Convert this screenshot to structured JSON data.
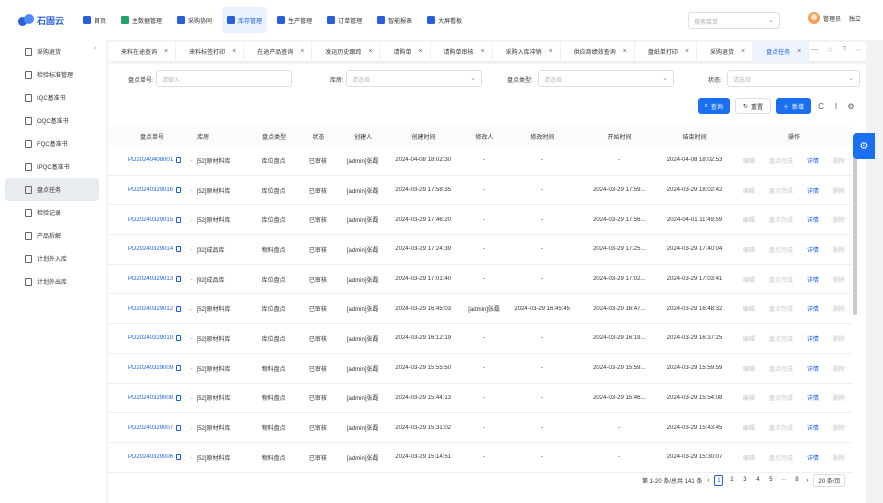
{
  "app": {
    "name": "石固云"
  },
  "topnav": {
    "items": [
      {
        "label": "首页",
        "icon": "home-icon",
        "color": "#2b5fd9"
      },
      {
        "label": "主数据管理",
        "icon": "database-icon",
        "color": "#22a06b"
      },
      {
        "label": "采购协同",
        "icon": "cart-icon",
        "color": "#2b5fd9"
      },
      {
        "label": "库存管理",
        "icon": "warehouse-icon",
        "color": "#2b5fd9",
        "active": true
      },
      {
        "label": "生产管理",
        "icon": "factory-icon",
        "color": "#2b5fd9"
      },
      {
        "label": "订单管理",
        "icon": "order-icon",
        "color": "#2b5fd9"
      },
      {
        "label": "智能报表",
        "icon": "report-icon",
        "color": "#2b5fd9"
      },
      {
        "label": "大屏看板",
        "icon": "dashboard-icon",
        "color": "#2b5fd9"
      }
    ],
    "search_placeholder": "搜索菜单",
    "user_name": "管理员",
    "logout": "独立"
  },
  "sidebar": {
    "items": [
      {
        "label": "采购退货"
      },
      {
        "label": "检验标准管理"
      },
      {
        "label": "IQC基准书"
      },
      {
        "label": "OQC基准书"
      },
      {
        "label": "FQC基准书"
      },
      {
        "label": "IPQC基准书"
      },
      {
        "label": "盘点任务",
        "active": true
      },
      {
        "label": "检验记录"
      },
      {
        "label": "产品拆解"
      },
      {
        "label": "计划外入库"
      },
      {
        "label": "计划外出库"
      }
    ]
  },
  "tabs": [
    {
      "label": "来料在途查询"
    },
    {
      "label": "来料标签打印"
    },
    {
      "label": "在途产品查询"
    },
    {
      "label": "发运历史跟踪"
    },
    {
      "label": "请购单"
    },
    {
      "label": "请购单审核"
    },
    {
      "label": "采购入库冲销"
    },
    {
      "label": "供应商绩效查询"
    },
    {
      "label": "盘纸单打印"
    },
    {
      "label": "采购退货"
    },
    {
      "label": "盘点任务",
      "active": true
    }
  ],
  "filters": {
    "code_label": "盘点单号:",
    "code_placeholder": "请输入",
    "warehouse_label": "库房:",
    "warehouse_placeholder": "请选择",
    "type_label": "盘点类型:",
    "type_placeholder": "请选择",
    "status_label": "状态:",
    "status_placeholder": "请选择"
  },
  "actions": {
    "query": "查询",
    "reset": "重置",
    "add": "新增"
  },
  "table": {
    "headers": [
      "盘点单号",
      "库房",
      "盘点类型",
      "状态",
      "创建人",
      "创建时间",
      "修改人",
      "修改时间",
      "开始时间",
      "结束时间",
      "操作"
    ],
    "op_labels": [
      "编辑",
      "盘点完成",
      "详情",
      "删除"
    ],
    "rows": [
      {
        "code": "PD20240408001",
        "warehouse": "[52]原材料库",
        "type": "库位盘点",
        "status": "已审核",
        "creator": "[admin]张磊",
        "ctime": "2024-04-08 18:02:30",
        "modifier": "-",
        "mtime": "-",
        "start": "-",
        "end": "2024-04-08 18:02:53"
      },
      {
        "code": "PD20240329016",
        "warehouse": "[52]原材料库",
        "type": "库位盘点",
        "status": "已审核",
        "creator": "[admin]张磊",
        "ctime": "2024-03-29 17:58:35",
        "modifier": "-",
        "mtime": "-",
        "start": "2024-03-29 17:59...",
        "end": "2024-03-29 18:02:42"
      },
      {
        "code": "PD20240329015",
        "warehouse": "[52]原材料库",
        "type": "库位盘点",
        "status": "已审核",
        "creator": "[admin]张磊",
        "ctime": "2024-03-29 17:46:20",
        "modifier": "-",
        "mtime": "-",
        "start": "2024-03-29 17:56...",
        "end": "2024-04-01 11:49:59"
      },
      {
        "code": "PD20240329014",
        "warehouse": "[32]成品库",
        "type": "物料盘点",
        "status": "已审核",
        "creator": "[admin]张磊",
        "ctime": "2024-03-29 17:24:39",
        "modifier": "-",
        "mtime": "-",
        "start": "2024-03-29 17:25...",
        "end": "2024-03-29 17:40:04"
      },
      {
        "code": "PD20240329013",
        "warehouse": "[92]成品库",
        "type": "库位盘点",
        "status": "已审核",
        "creator": "[admin]张磊",
        "ctime": "2024-03-29 17:01:40",
        "modifier": "-",
        "mtime": "-",
        "start": "2024-03-29 17:02...",
        "end": "2024-03-29 17:03:41"
      },
      {
        "code": "PD20240329012",
        "warehouse": "[52]原材料库",
        "type": "库位盘点",
        "status": "已审核",
        "creator": "[admin]张磊",
        "ctime": "2024-03-29 16:45:03",
        "modifier": "[admin]张磊",
        "mtime": "2024-03-29 16:45:45",
        "start": "2024-03-29 16:47...",
        "end": "2024-03-29 16:48:32"
      },
      {
        "code": "PD20240329010",
        "warehouse": "[52]原材料库",
        "type": "库位盘点",
        "status": "已审核",
        "creator": "[admin]张磊",
        "ctime": "2024-03-29 16:12:19",
        "modifier": "-",
        "mtime": "-",
        "start": "2024-03-29 16:19...",
        "end": "2024-03-29 16:37:25"
      },
      {
        "code": "PD20240329009",
        "warehouse": "[52]原材料库",
        "type": "物料盘点",
        "status": "已审核",
        "creator": "[admin]张磊",
        "ctime": "2024-03-29 15:55:50",
        "modifier": "-",
        "mtime": "-",
        "start": "2024-03-29 15:59...",
        "end": "2024-03-29 15:59:59"
      },
      {
        "code": "PD20240329008",
        "warehouse": "[52]原材料库",
        "type": "物料盘点",
        "status": "已审核",
        "creator": "[admin]张磊",
        "ctime": "2024-03-29 15:44:13",
        "modifier": "-",
        "mtime": "-",
        "start": "2024-03-29 15:46...",
        "end": "2024-03-29 15:54:08"
      },
      {
        "code": "PD20240329007",
        "warehouse": "[52]原材料库",
        "type": "物料盘点",
        "status": "已审核",
        "creator": "[admin]张磊",
        "ctime": "2024-03-29 15:31:02",
        "modifier": "-",
        "mtime": "-",
        "start": "-",
        "end": "2024-03-29 15:43:45"
      },
      {
        "code": "PD20240329006",
        "warehouse": "[52]原材料库",
        "type": "物料盘点",
        "status": "已审核",
        "creator": "[admin]张磊",
        "ctime": "2024-03-29 15:14:51",
        "modifier": "-",
        "mtime": "-",
        "start": "-",
        "end": "2024-03-29 15:30:07"
      }
    ]
  },
  "pagination": {
    "summary": "第 1-20 条/总共 141 条",
    "pages": [
      "1",
      "2",
      "3",
      "4",
      "5",
      "···",
      "8"
    ],
    "current": "1",
    "size": "20 条/页"
  }
}
